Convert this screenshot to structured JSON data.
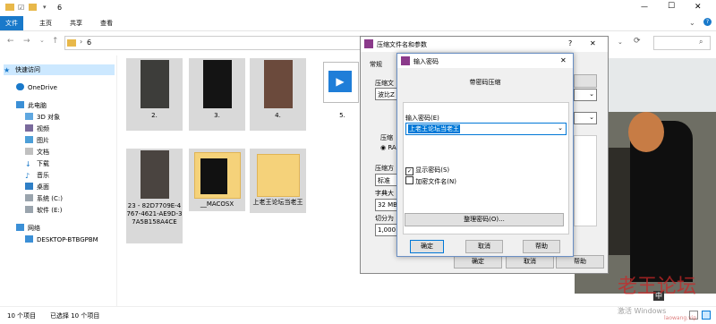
{
  "window": {
    "path_title": "6",
    "minimize": "—",
    "maximize": "☐",
    "close": "✕"
  },
  "ribbon": {
    "tabs": [
      "文件",
      "主页",
      "共享",
      "查看"
    ]
  },
  "address": {
    "path": "6"
  },
  "sidebar": {
    "items": [
      "快速访问",
      "OneDrive",
      "此电脑",
      "3D 对象",
      "视频",
      "图片",
      "文档",
      "下载",
      "音乐",
      "桌面",
      "系统 (C:)",
      "软件 (E:)",
      "网络",
      "DESKTOP-BTBGPBM"
    ]
  },
  "files": [
    {
      "name": "2."
    },
    {
      "name": "3."
    },
    {
      "name": "4."
    },
    {
      "name": "5."
    },
    {
      "name": "23 - 82D7709E-4767-4621-AE9D-37A5B158A4CE"
    },
    {
      "name": "__MACOSX"
    },
    {
      "name": "上老王论坛当老王"
    }
  ],
  "status": {
    "count": "10 个项目",
    "selected": "已选择 10 个项目"
  },
  "back_dialog": {
    "title": "压缩文件名和参数",
    "help": "?",
    "close": "✕",
    "tab": "常规",
    "label_archive": "压缩文",
    "value_archive": "波比Z",
    "label_format": "压缩",
    "radio": "RA",
    "label_method": "压缩方",
    "value_method": "标准",
    "label_dict": "字典大",
    "value_dict": "32 MB",
    "label_split": "切分为",
    "value_split": "1,000",
    "btn_ok": "确定",
    "btn_cancel": "取消",
    "btn_help": "帮助"
  },
  "pwd_dialog": {
    "title": "输入密码",
    "close": "✕",
    "heading": "带密码压缩",
    "label": "输入密码(E)",
    "value": "上老王论坛当老王",
    "show_pwd": "显示密码(S)",
    "encrypt_names": "加密文件名(N)",
    "manage": "整理密码(O)...",
    "btn_ok": "确定",
    "btn_cancel": "取消",
    "btn_help": "帮助"
  },
  "taskbar": {
    "ime": "中",
    "watermark": "老王论坛",
    "watermark2": "激活 Windows",
    "watermark3": "laowang.vip"
  },
  "colors": {
    "accent": "#1979ca",
    "selection": "#0078d7"
  }
}
